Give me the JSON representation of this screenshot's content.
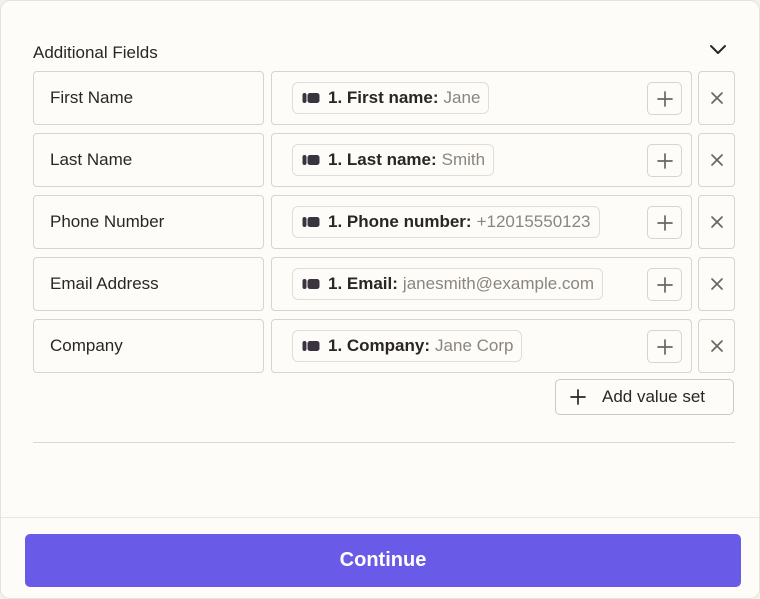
{
  "section": {
    "title": "Additional Fields",
    "toggle_icon": "chevron-down-icon"
  },
  "fields": [
    {
      "label": "First Name",
      "token_key": "1. First name:",
      "token_value": "Jane"
    },
    {
      "label": "Last Name",
      "token_key": "1. Last name:",
      "token_value": "Smith"
    },
    {
      "label": "Phone Number",
      "token_key": "1. Phone number:",
      "token_value": "+12015550123"
    },
    {
      "label": "Email Address",
      "token_key": "1. Email:",
      "token_value": "janesmith@example.com"
    },
    {
      "label": "Company",
      "token_key": "1. Company:",
      "token_value": "Jane Corp"
    }
  ],
  "icons": {
    "token": "step-icon",
    "insert": "plus-icon",
    "remove": "close-icon"
  },
  "add_value_set_label": "Add value set",
  "continue_label": "Continue",
  "colors": {
    "accent": "#695be8",
    "background": "#fdfcf9",
    "border": "#d8d4cb",
    "text": "#2b2622",
    "muted_text": "#8b857d"
  }
}
